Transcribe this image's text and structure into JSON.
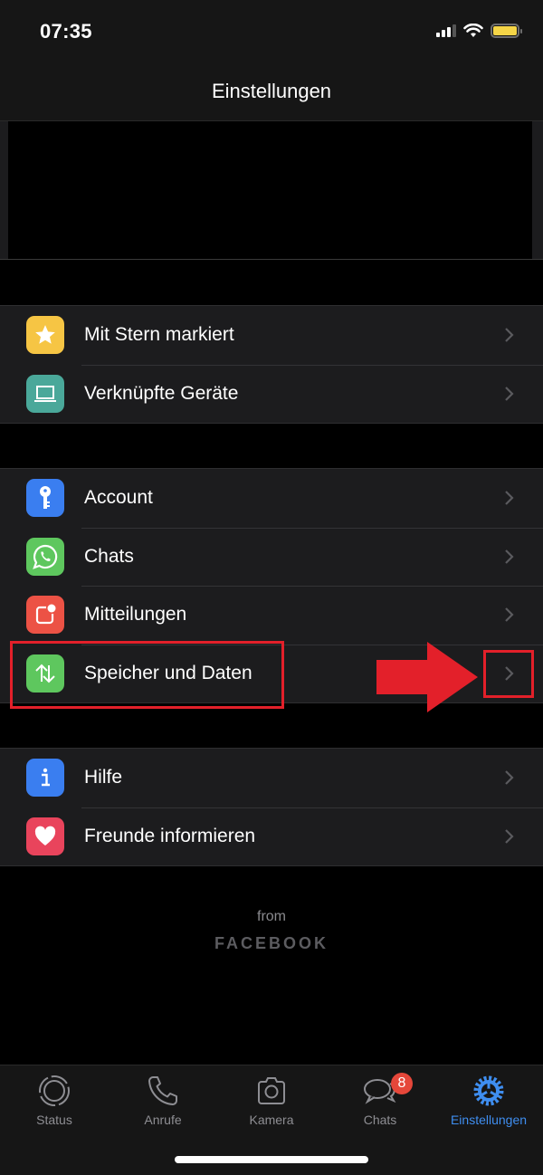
{
  "status_bar": {
    "time": "07:35",
    "battery_color": "#f5d547"
  },
  "header": {
    "title": "Einstellungen"
  },
  "groups": [
    {
      "items": [
        {
          "label": "Mit Stern markiert",
          "icon": "star-icon",
          "color": "#f6c544"
        },
        {
          "label": "Verknüpfte Geräte",
          "icon": "laptop-icon",
          "color": "#4aa89a"
        }
      ]
    },
    {
      "items": [
        {
          "label": "Account",
          "icon": "key-icon",
          "color": "#3a7ef0"
        },
        {
          "label": "Chats",
          "icon": "whatsapp-icon",
          "color": "#5ec75e"
        },
        {
          "label": "Mitteilungen",
          "icon": "notification-icon",
          "color": "#ec5245"
        },
        {
          "label": "Speicher und Daten",
          "icon": "arrows-updown-icon",
          "color": "#5ec75e"
        }
      ]
    },
    {
      "items": [
        {
          "label": "Hilfe",
          "icon": "info-icon",
          "color": "#3a7ef0"
        },
        {
          "label": "Freunde informieren",
          "icon": "heart-icon",
          "color": "#e9445c"
        }
      ]
    }
  ],
  "footer": {
    "from": "from",
    "brand": "FACEBOOK"
  },
  "tabbar": {
    "tabs": [
      {
        "label": "Status",
        "icon": "status-icon"
      },
      {
        "label": "Anrufe",
        "icon": "phone-icon"
      },
      {
        "label": "Kamera",
        "icon": "camera-icon"
      },
      {
        "label": "Chats",
        "icon": "chats-icon",
        "badge": "8"
      },
      {
        "label": "Einstellungen",
        "icon": "gear-icon",
        "active": true
      }
    ],
    "active_color": "#3f8ef0"
  },
  "annotation": {
    "color": "#e3202a",
    "highlighted_item": "Speicher und Daten"
  }
}
